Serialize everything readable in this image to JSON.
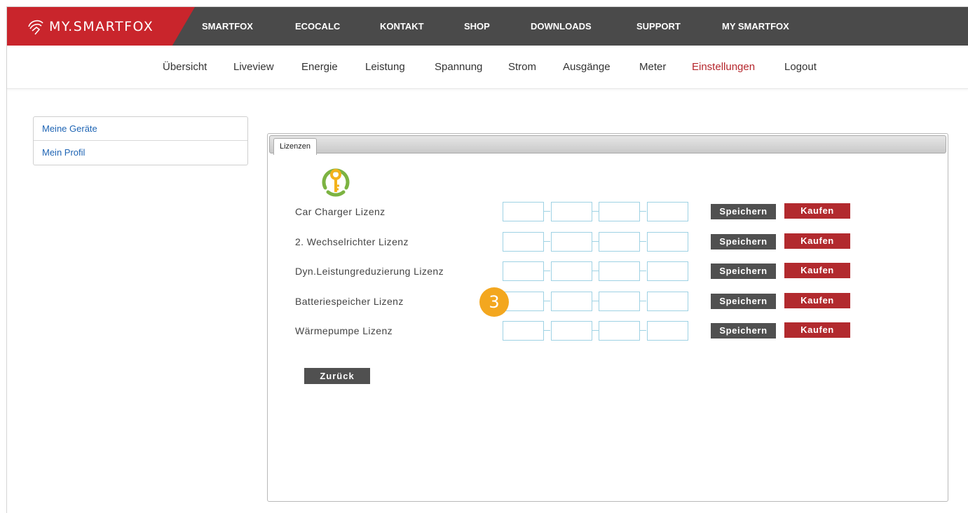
{
  "brand": {
    "name": "MY.SMARTFOX",
    "color": "#c9252c"
  },
  "top_nav": [
    "SMARTFOX",
    "ECOCALC",
    "KONTAKT",
    "SHOP",
    "DOWNLOADS",
    "SUPPORT",
    "MY SMARTFOX"
  ],
  "sub_nav": {
    "items": [
      "Übersicht",
      "Liveview",
      "Energie",
      "Leistung",
      "Spannung",
      "Strom",
      "Ausgänge",
      "Meter",
      "Einstellungen",
      "Logout"
    ],
    "active": "Einstellungen"
  },
  "side_menu": [
    "Meine Geräte",
    "Mein Profil"
  ],
  "panel": {
    "tab_label": "Lizenzen",
    "icon": "key-icon",
    "licenses": [
      {
        "label": "Car Charger Lizenz",
        "save": "Speichern",
        "buy": "Kaufen"
      },
      {
        "label": "2. Wechselrichter Lizenz",
        "save": "Speichern",
        "buy": "Kaufen"
      },
      {
        "label": "Dyn.Leistungreduzierung Lizenz",
        "save": "Speichern",
        "buy": "Kaufen"
      },
      {
        "label": "Batteriespeicher Lizenz",
        "save": "Speichern",
        "buy": "Kaufen"
      },
      {
        "label": "Wärmepumpe Lizenz",
        "save": "Speichern",
        "buy": "Kaufen"
      }
    ],
    "back_label": "Zurück"
  },
  "callout": {
    "number": "3",
    "color": "#f3a71f"
  }
}
